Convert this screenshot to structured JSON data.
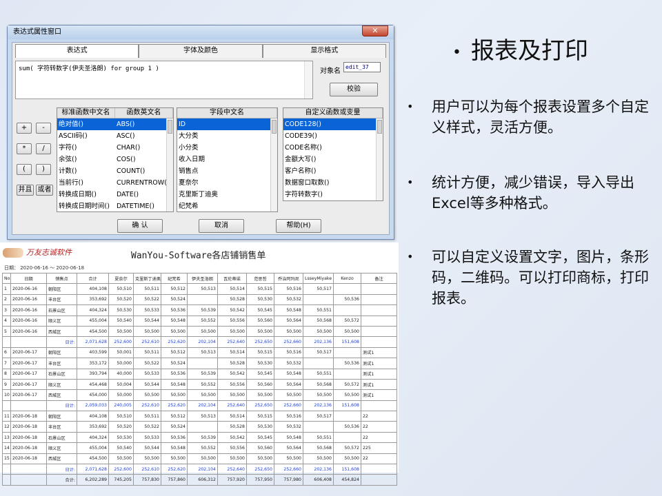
{
  "dialog": {
    "title": "表达式属性窗口",
    "close_label": "✕",
    "tabs": [
      "表达式",
      "字体及颜色",
      "显示格式"
    ],
    "expression": "sum( 字符转数字(伊夫圣洛朗) for group 1  )",
    "objname_label": "对象名",
    "objname_value": "edit_37",
    "verify_button": "校验",
    "operators": [
      "+",
      "-",
      "*",
      "/",
      "(",
      ")",
      "并且",
      "或者"
    ],
    "func_list": {
      "headers": [
        "标准函数中文名",
        "函数英文名"
      ],
      "rows": [
        [
          "绝对值()",
          "ABS()"
        ],
        [
          "ASCII码()",
          "ASC()"
        ],
        [
          "字符()",
          "CHAR()"
        ],
        [
          "余弦()",
          "COS()"
        ],
        [
          "计数()",
          "COUNT()"
        ],
        [
          "当前行()",
          "CURRENTROW()"
        ],
        [
          "转换成日期()",
          "DATE()"
        ],
        [
          "转换成日期时间()",
          "DATETIME()"
        ]
      ]
    },
    "field_list": {
      "header": "字段中文名",
      "rows": [
        "ID",
        "大分类",
        "小分类",
        "收入日期",
        "销售点",
        "夏奈尔",
        "克里斯丁迪奥",
        "纪梵希"
      ]
    },
    "custom_list": {
      "header": "自定义函数或变量",
      "rows": [
        "CODE128()",
        "CODE39()",
        "CODE名称()",
        "金额大写()",
        "客户名称()",
        "数据窗口取数()",
        "字符转数字()"
      ]
    },
    "ok_button": "确 认",
    "cancel_button": "取消",
    "help_button": "帮助(H)"
  },
  "report": {
    "logo_text": "万友志诚软件",
    "title": "WanYou-Software各店铺销售单",
    "date_range": "日期： 2020-06-16 ～ 2020-06-18",
    "columns": [
      "No",
      "日期",
      "销售点",
      "合计",
      "夏奈尔",
      "克里斯丁迪奥",
      "纪梵希",
      "伊夫圣洛朗",
      "瓦伦蒂诺",
      "范思哲",
      "乔治阿玛尼",
      "LsseyMiyake",
      "Kenzo",
      "备注"
    ],
    "rows": [
      {
        "type": "data",
        "cells": [
          "1",
          "2020-06-16",
          "朝阳区",
          "404,108",
          "50,510",
          "50,511",
          "50,512",
          "50,513",
          "50,514",
          "50,515",
          "50,516",
          "50,517",
          "",
          ""
        ]
      },
      {
        "type": "data",
        "cells": [
          "2",
          "2020-06-16",
          "丰台区",
          "353,692",
          "50,520",
          "50,522",
          "50,524",
          "",
          "50,528",
          "50,530",
          "50,532",
          "",
          "50,536",
          ""
        ]
      },
      {
        "type": "data",
        "cells": [
          "3",
          "2020-06-16",
          "石景山区",
          "404,324",
          "50,530",
          "50,533",
          "50,536",
          "50,539",
          "50,542",
          "50,545",
          "50,548",
          "50,551",
          "",
          ""
        ]
      },
      {
        "type": "data",
        "cells": [
          "4",
          "2020-06-16",
          "顺义区",
          "455,004",
          "50,540",
          "50,544",
          "50,548",
          "50,552",
          "50,556",
          "50,560",
          "50,564",
          "50,568",
          "50,572",
          ""
        ]
      },
      {
        "type": "data",
        "cells": [
          "5",
          "2020-06-16",
          "西城区",
          "454,500",
          "50,500",
          "50,500",
          "50,500",
          "50,500",
          "50,500",
          "50,500",
          "50,500",
          "50,500",
          "50,500",
          ""
        ]
      },
      {
        "type": "subtotal",
        "cells": [
          "",
          "",
          "日计:",
          "2,071,628",
          "252,600",
          "252,610",
          "252,620",
          "202,104",
          "252,640",
          "252,650",
          "252,660",
          "202,136",
          "151,608",
          ""
        ]
      },
      {
        "type": "data",
        "cells": [
          "6",
          "2020-06-17",
          "朝阳区",
          "403,599",
          "50,001",
          "50,511",
          "50,512",
          "50,513",
          "50,514",
          "50,515",
          "50,516",
          "50,517",
          "",
          "测试1"
        ]
      },
      {
        "type": "data",
        "cells": [
          "7",
          "2020-06-17",
          "丰台区",
          "353,172",
          "50,000",
          "50,522",
          "50,524",
          "",
          "50,528",
          "50,530",
          "50,532",
          "",
          "50,536",
          "测试1"
        ]
      },
      {
        "type": "data",
        "cells": [
          "8",
          "2020-06-17",
          "石景山区",
          "393,794",
          "40,000",
          "50,533",
          "50,536",
          "50,539",
          "50,542",
          "50,545",
          "50,548",
          "50,551",
          "",
          "测试1"
        ]
      },
      {
        "type": "data",
        "cells": [
          "9",
          "2020-06-17",
          "顺义区",
          "454,468",
          "50,004",
          "50,544",
          "50,548",
          "50,552",
          "50,556",
          "50,560",
          "50,564",
          "50,568",
          "50,572",
          "测试1"
        ]
      },
      {
        "type": "data",
        "cells": [
          "10",
          "2020-06-17",
          "西城区",
          "454,000",
          "50,000",
          "50,500",
          "50,500",
          "50,500",
          "50,500",
          "50,500",
          "50,500",
          "50,500",
          "50,500",
          "测试1"
        ]
      },
      {
        "type": "subtotal",
        "cells": [
          "",
          "",
          "日计:",
          "2,059,033",
          "240,005",
          "252,610",
          "252,620",
          "202,104",
          "252,640",
          "252,650",
          "252,660",
          "202,136",
          "151,608",
          ""
        ]
      },
      {
        "type": "data",
        "cells": [
          "11",
          "2020-06-18",
          "朝阳区",
          "404,108",
          "50,510",
          "50,511",
          "50,512",
          "50,513",
          "50,514",
          "50,515",
          "50,516",
          "50,517",
          "",
          "22"
        ]
      },
      {
        "type": "data",
        "cells": [
          "12",
          "2020-06-18",
          "丰台区",
          "353,692",
          "50,520",
          "50,522",
          "50,524",
          "",
          "50,528",
          "50,530",
          "50,532",
          "",
          "50,536",
          "22"
        ]
      },
      {
        "type": "data",
        "cells": [
          "13",
          "2020-06-18",
          "石景山区",
          "404,324",
          "50,530",
          "50,533",
          "50,536",
          "50,539",
          "50,542",
          "50,545",
          "50,548",
          "50,551",
          "",
          "22"
        ]
      },
      {
        "type": "data",
        "cells": [
          "14",
          "2020-06-18",
          "顺义区",
          "455,004",
          "50,540",
          "50,544",
          "50,548",
          "50,552",
          "50,556",
          "50,560",
          "50,564",
          "50,568",
          "50,572",
          "225"
        ]
      },
      {
        "type": "data",
        "cells": [
          "15",
          "2020-06-18",
          "西城区",
          "454,500",
          "50,500",
          "50,500",
          "50,500",
          "50,500",
          "50,500",
          "50,500",
          "50,500",
          "50,500",
          "50,500",
          "22"
        ]
      },
      {
        "type": "subtotal",
        "cells": [
          "",
          "",
          "日计:",
          "2,071,628",
          "252,600",
          "252,610",
          "252,620",
          "202,104",
          "252,640",
          "252,650",
          "252,660",
          "202,136",
          "151,608",
          ""
        ]
      },
      {
        "type": "total",
        "cells": [
          "",
          "",
          "合计:",
          "6,202,289",
          "745,205",
          "757,830",
          "757,860",
          "606,312",
          "757,920",
          "757,950",
          "757,980",
          "606,408",
          "454,824",
          ""
        ]
      }
    ]
  },
  "slide": {
    "heading": "报表及打印",
    "heading_mark": "•",
    "bullets": [
      "用户可以为每个报表设置多个自定义样式，灵活方便。",
      "统计方便，减少错误，导入导出Excel等多种格式。",
      "可以自定义设置文字，图片，条形码，二维码。可以打印商标，打印报表。"
    ],
    "bullet_mark": "•"
  }
}
